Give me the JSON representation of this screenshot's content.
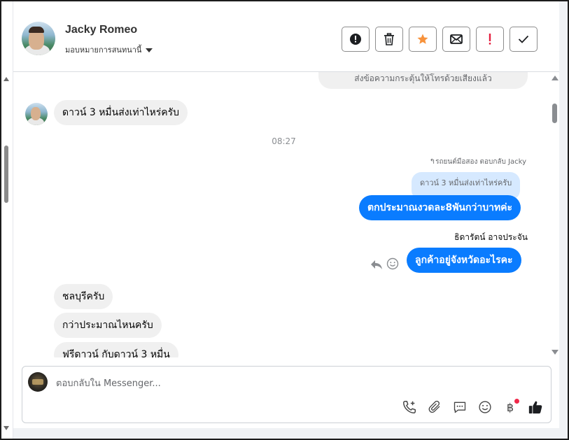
{
  "header": {
    "contact_name": "Jacky Romeo",
    "assign_label": "มอบหมายการสนทนานี้",
    "actions": [
      {
        "name": "spam-button",
        "icon": "alert-circle-icon"
      },
      {
        "name": "delete-button",
        "icon": "trash-icon"
      },
      {
        "name": "star-button",
        "icon": "star-icon"
      },
      {
        "name": "mark-unread-button",
        "icon": "envelope-icon"
      },
      {
        "name": "follow-up-button",
        "icon": "exclamation-icon"
      },
      {
        "name": "mark-done-button",
        "icon": "check-icon"
      }
    ]
  },
  "colors": {
    "accent_blue": "#0a7cff",
    "star": "#f7923b",
    "alert_red": "#e41e3f",
    "notification_dot": "#f02849"
  },
  "messages": {
    "previous_outgoing": "ส่งข้อความกระตุ้นให้โทรด้วยเสียงแล้ว",
    "incoming_1": "ดาวน์ 3 หมื่นส่งเท่าไหร่ครับ",
    "timestamp": "08:27",
    "reply_meta": "รถยนต์มือสอง ตอบกลับ Jacky",
    "quoted": "ดาวน์ 3 หมื่นส่งเท่าไหร่ครับ",
    "outgoing_1": "ตกประมาณงวดละ8พันกว่าบาทค่ะ",
    "sender_name": "ธิดารัตน์ อาจประจัน",
    "outgoing_2": "ลูกค้าอยู่จังหวัดอะไรคะ",
    "incoming_2": "ชลบุรีครับ",
    "incoming_3": "กว่าประมาณไหนครับ",
    "incoming_4": "ฟรีดาวน์ กับดาวน์ 3 หมื่น"
  },
  "composer": {
    "placeholder": "ตอบกลับใน Messenger...",
    "tools": [
      "phone-plus-icon",
      "paperclip-icon",
      "chat-bubble-icon",
      "smiley-icon",
      "baht-icon",
      "thumbs-up-icon"
    ],
    "baht_symbol": "฿"
  }
}
